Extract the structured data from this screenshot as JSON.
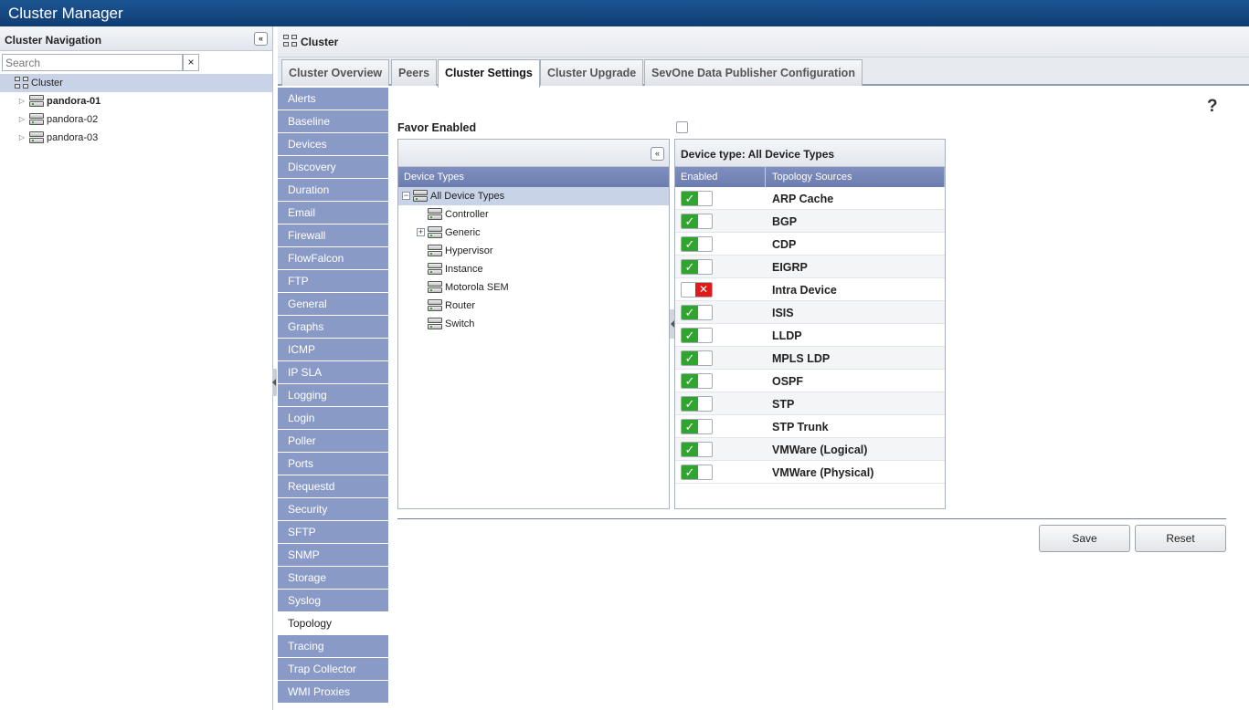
{
  "app": {
    "title": "Cluster Manager"
  },
  "nav": {
    "header": "Cluster Navigation",
    "collapse_icon": "«",
    "search": {
      "placeholder": "Search",
      "value": "",
      "clear_label": "×"
    },
    "tree": {
      "root": "Cluster",
      "nodes": [
        "pandora-01",
        "pandora-02",
        "pandora-03"
      ]
    }
  },
  "content": {
    "header": "Cluster",
    "tabs": [
      "Cluster Overview",
      "Peers",
      "Cluster Settings",
      "Cluster Upgrade",
      "SevOne Data Publisher Configuration"
    ],
    "active_tab": "Cluster Settings",
    "menu": [
      "Alerts",
      "Baseline",
      "Devices",
      "Discovery",
      "Duration",
      "Email",
      "Firewall",
      "FlowFalcon",
      "FTP",
      "General",
      "Graphs",
      "ICMP",
      "IP SLA",
      "Logging",
      "Login",
      "Poller",
      "Ports",
      "Requestd",
      "Security",
      "SFTP",
      "SNMP",
      "Storage",
      "Syslog",
      "Topology",
      "Tracing",
      "Trap Collector",
      "WMI Proxies"
    ],
    "active_menu": "Topology"
  },
  "topology": {
    "help": "?",
    "favor_label": "Favor Enabled",
    "favor_checked": false,
    "device_types": {
      "column": "Device Types",
      "root": "All Device Types",
      "children": [
        "Controller",
        "Generic",
        "Hypervisor",
        "Instance",
        "Motorola SEM",
        "Router",
        "Switch"
      ],
      "expand_minus": "−",
      "expand_plus": "+"
    },
    "sources": {
      "title": "Device type: All Device Types",
      "col_enabled": "Enabled",
      "col_sources": "Topology Sources",
      "check_glyph": "✓",
      "cross_glyph": "✕",
      "rows": [
        {
          "name": "ARP Cache",
          "enabled": true
        },
        {
          "name": "BGP",
          "enabled": true
        },
        {
          "name": "CDP",
          "enabled": true
        },
        {
          "name": "EIGRP",
          "enabled": true
        },
        {
          "name": "Intra Device",
          "enabled": false
        },
        {
          "name": "ISIS",
          "enabled": true
        },
        {
          "name": "LLDP",
          "enabled": true
        },
        {
          "name": "MPLS LDP",
          "enabled": true
        },
        {
          "name": "OSPF",
          "enabled": true
        },
        {
          "name": "STP",
          "enabled": true
        },
        {
          "name": "STP Trunk",
          "enabled": true
        },
        {
          "name": "VMWare (Logical)",
          "enabled": true
        },
        {
          "name": "VMWare (Physical)",
          "enabled": true
        }
      ]
    },
    "buttons": {
      "save": "Save",
      "reset": "Reset"
    }
  },
  "colors": {
    "title_bar": "#0f3d73",
    "menu": "#8a9ac7",
    "header_row": "#6b7cae",
    "on": "#2fa52f",
    "off": "#e01b1b"
  }
}
